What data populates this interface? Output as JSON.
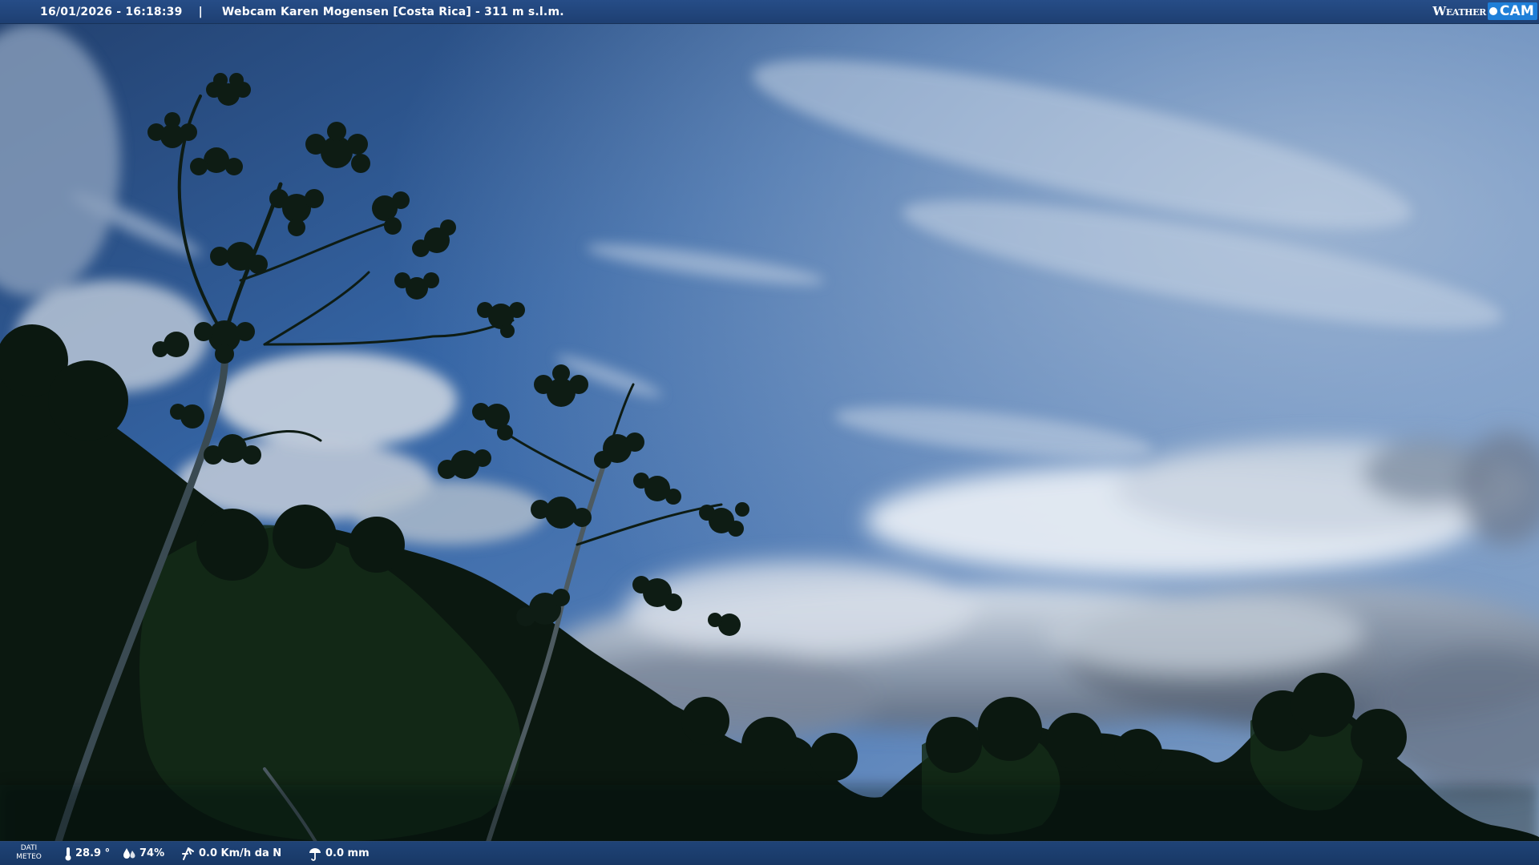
{
  "header": {
    "timestamp": "16/01/2026 - 16:18:39",
    "separator": "|",
    "location": "Webcam Karen Mogensen [Costa Rica] - 311 m s.l.m.",
    "logo_weather": "Weather",
    "logo_cam": "CAM"
  },
  "footer": {
    "meteo_label_line1": "DATI",
    "meteo_label_line2": "METEO",
    "temperature": "28.9 °",
    "humidity": "74%",
    "wind": "0.0 Km/h da N",
    "rain": "0.0 mm"
  },
  "icons": {
    "temperature": "thermometer-icon",
    "humidity": "humidity-icon",
    "wind": "wind-icon",
    "rain": "rain-icon"
  },
  "colors": {
    "bar_background": "#1f4377",
    "logo_accent": "#1f7fd8",
    "sky_top": "#2b4d7e",
    "sky_horizon": "#9fb6d1",
    "foliage": "#0c1a12"
  }
}
